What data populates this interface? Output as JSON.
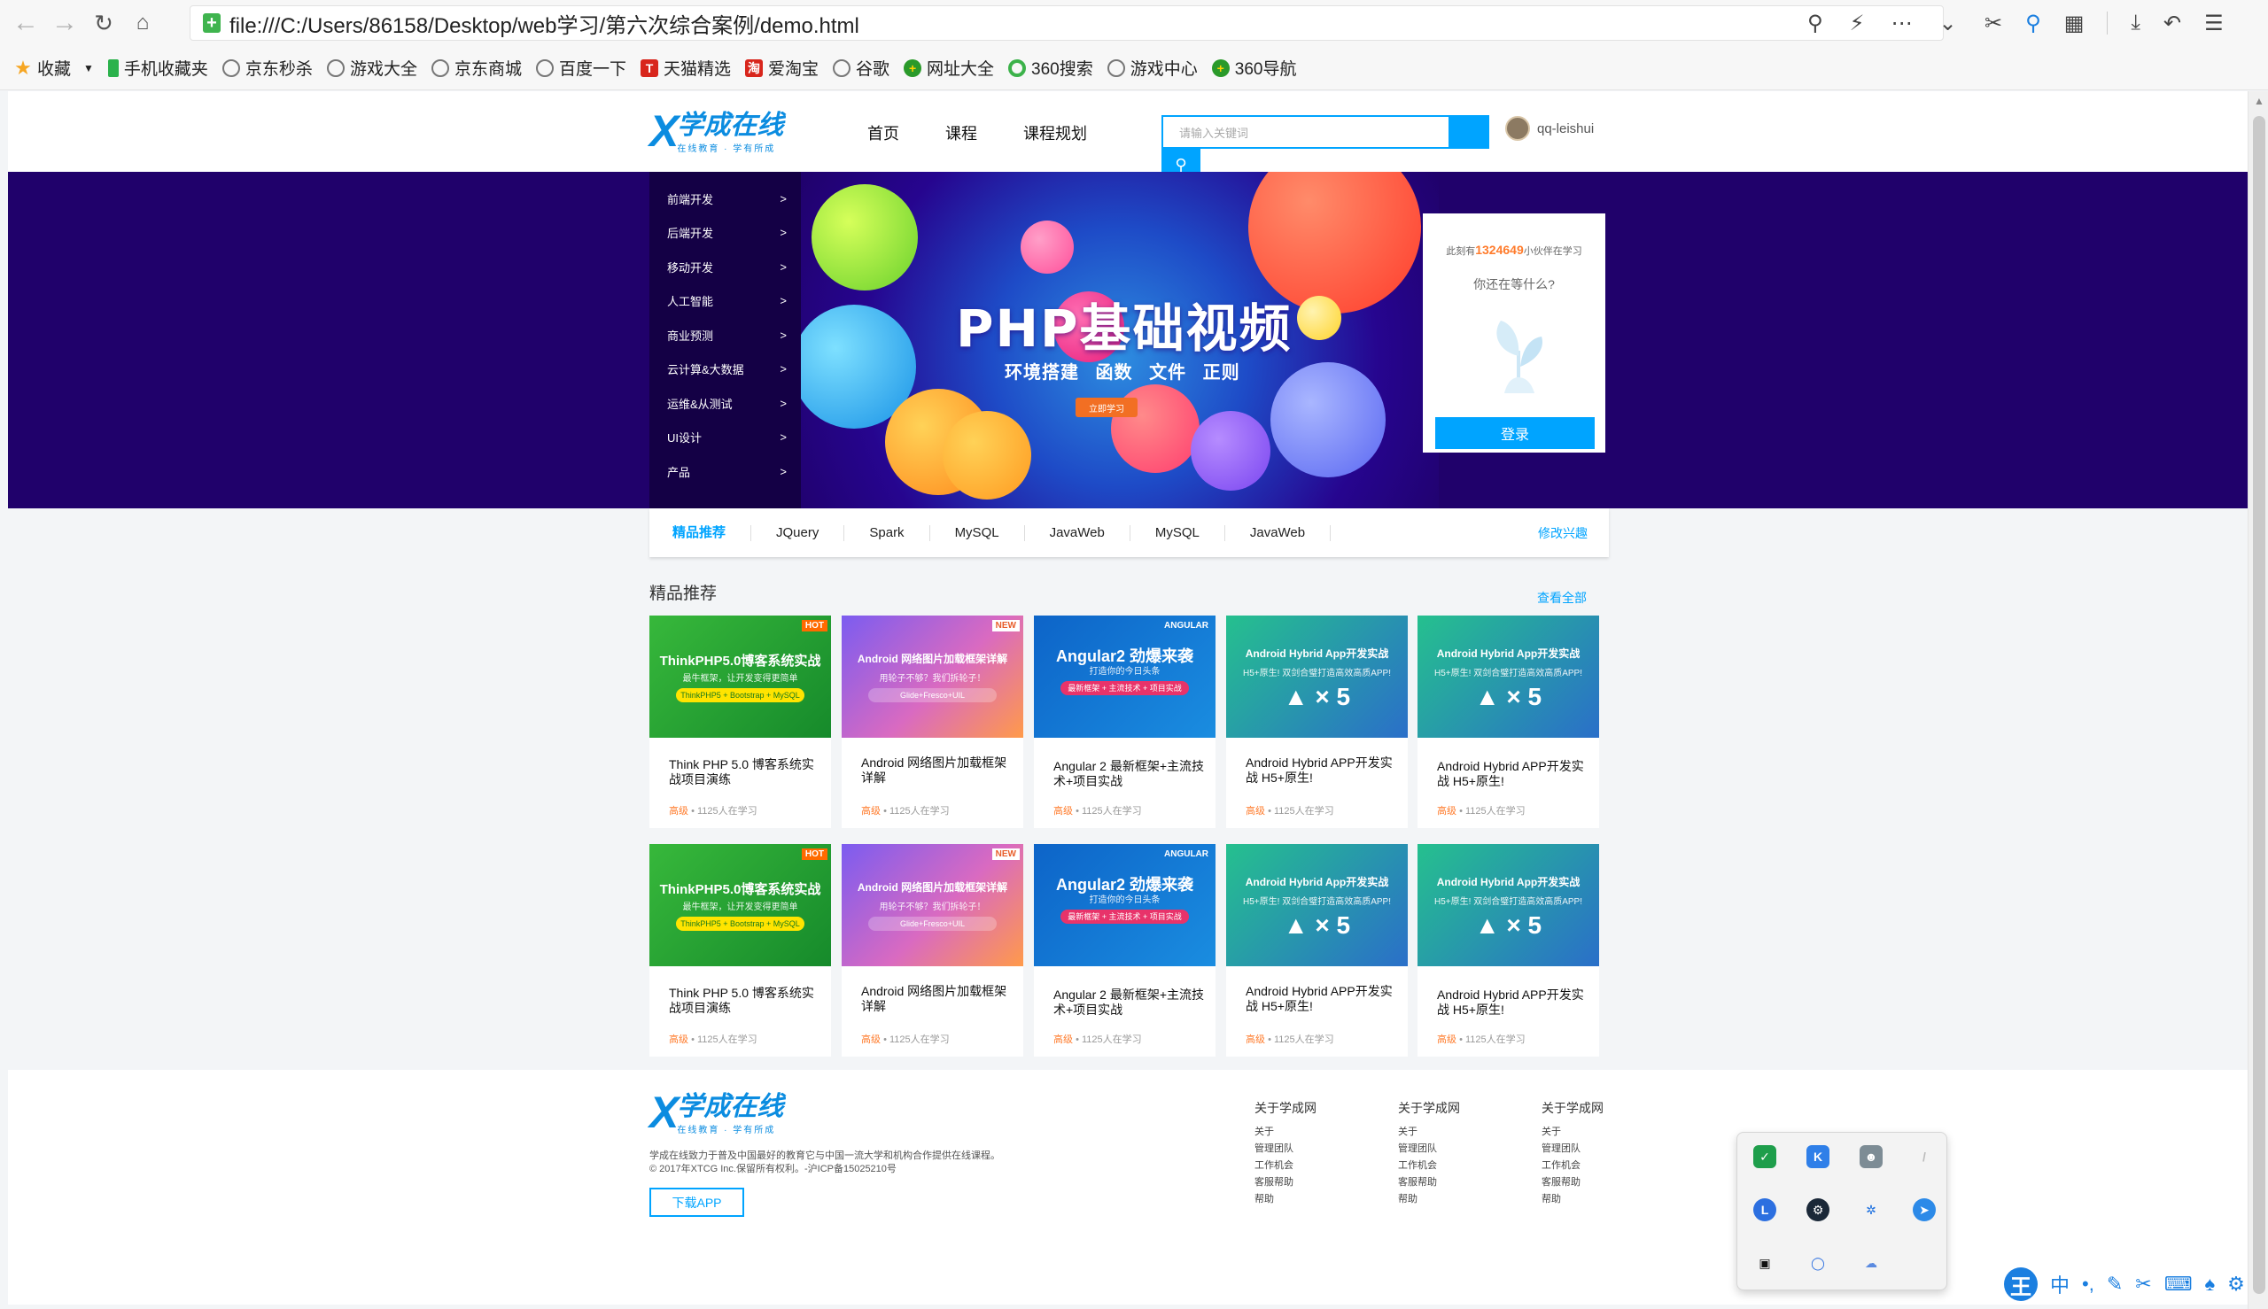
{
  "browser": {
    "url": "file:///C:/Users/86158/Desktop/web学习/第六次综合案例/demo.html",
    "bookmarks": [
      "收藏",
      "手机收藏夹",
      "京东秒杀",
      "游戏大全",
      "京东商城",
      "百度一下",
      "天猫精选",
      "爱淘宝",
      "谷歌",
      "网址大全",
      "360搜索",
      "游戏中心",
      "360导航"
    ]
  },
  "header": {
    "logo_title": "学成在线",
    "logo_slogan": "在线教育 · 学有所成",
    "nav": [
      "首页",
      "课程",
      "课程规划"
    ],
    "search_placeholder": "请输入关键词",
    "username": "qq-leishui"
  },
  "banner": {
    "title": "PHP基础视频",
    "subtitle": "环境搭建 函数 文件 正则",
    "cta": "立即学习",
    "categories": [
      "前端开发",
      "后端开发",
      "移动开发",
      "人工智能",
      "商业预测",
      "云计算&大数据",
      "运维&从测试",
      "UI设计",
      "产品"
    ],
    "arrow": ">",
    "login_card": {
      "online_prefix": "此刻有",
      "online_count": "1324649",
      "online_suffix": "小伙伴在学习",
      "question": "你还在等什么?",
      "login_button": "登录"
    }
  },
  "tabs": {
    "items": [
      "精品推荐",
      "JQuery",
      "Spark",
      "MySQL",
      "JavaWeb",
      "MySQL",
      "JavaWeb"
    ],
    "edit": "修改兴趣"
  },
  "courses": {
    "section_title": "精品推荐",
    "view_all": "查看全部",
    "level": "高级",
    "learners": "• 1125人在学习",
    "items": [
      {
        "title": "Think PHP 5.0 博客系统实战项目演练",
        "thumb": "ThinkPHP5.0博客系统实战",
        "sub": "最牛框架，让开发变得更简单",
        "pill": "ThinkPHP5 + Bootstrap + MySQL",
        "badge": "HOT"
      },
      {
        "title": "Android 网络图片加载框架详解",
        "thumb": "Android 网络图片加载框架详解",
        "sub": "用轮子不够？我们拆轮子！",
        "pill": "Glide+Fresco+UIL",
        "badge": "NEW"
      },
      {
        "title": "Angular 2 最新框架+主流技术+项目实战",
        "thumb": "Angular2 劲爆来袭",
        "sub": "打造你的今日头条",
        "pill": "最新框架 + 主流技术 + 项目实战",
        "badge": "ANGULAR"
      },
      {
        "title": "Android Hybrid APP开发实战 H5+原生!",
        "thumb": "Android Hybrid App开发实战",
        "sub": "H5+原生! 双剑合璧打造高效高质APP!",
        "pill": "",
        "badge": ""
      },
      {
        "title": "Android Hybrid APP开发实战 H5+原生!",
        "thumb": "Android Hybrid App开发实战",
        "sub": "H5+原生! 双剑合璧打造高效高质APP!",
        "pill": "",
        "badge": ""
      }
    ]
  },
  "footer": {
    "desc_line1": "学成在线致力于普及中国最好的教育它与中国一流大学和机构合作提供在线课程。",
    "desc_line2": "© 2017年XTCG Inc.保留所有权利。-沪ICP备15025210号",
    "download": "下载APP",
    "columns": [
      {
        "heading": "关于学成网",
        "links": [
          "关于",
          "管理团队",
          "工作机会",
          "客服帮助",
          "帮助"
        ]
      },
      {
        "heading": "关于学成网",
        "links": [
          "关于",
          "管理团队",
          "工作机会",
          "客服帮助",
          "帮助"
        ]
      },
      {
        "heading": "关于学成网",
        "links": [
          "关于",
          "管理团队",
          "工作机会",
          "客服帮助",
          "帮助"
        ]
      }
    ]
  },
  "ime": {
    "mode": "中"
  },
  "colors": {
    "brand": "#00a4ff",
    "banner_bg": "#20016b",
    "accent_orange": "#ff7c2d"
  }
}
